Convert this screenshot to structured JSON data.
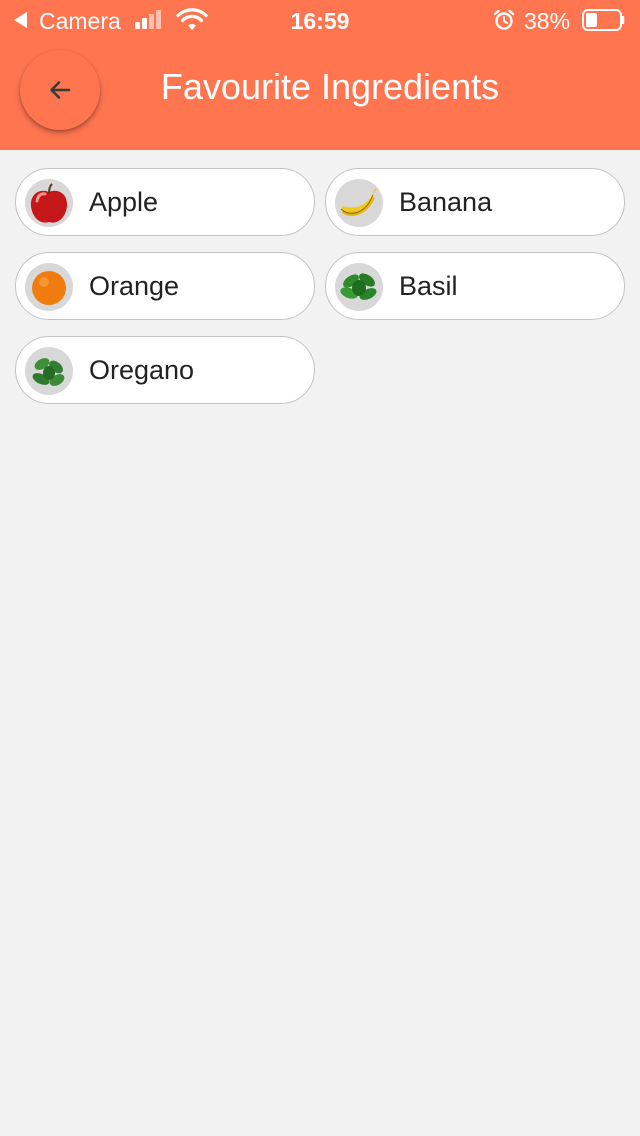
{
  "status_bar": {
    "back_app": "Camera",
    "time": "16:59",
    "battery": "38%",
    "icons": [
      "back-triangle-icon",
      "signal-icon",
      "wifi-icon",
      "alarm-icon",
      "battery-icon"
    ]
  },
  "header": {
    "title": "Favourite Ingredients",
    "back_icon": "arrow-left-icon",
    "color": "#ff7550"
  },
  "ingredients": [
    {
      "label": "Apple",
      "icon": "apple-icon"
    },
    {
      "label": "Banana",
      "icon": "banana-icon"
    },
    {
      "label": "Orange",
      "icon": "orange-icon"
    },
    {
      "label": "Basil",
      "icon": "basil-icon"
    },
    {
      "label": "Oregano",
      "icon": "oregano-icon"
    }
  ]
}
